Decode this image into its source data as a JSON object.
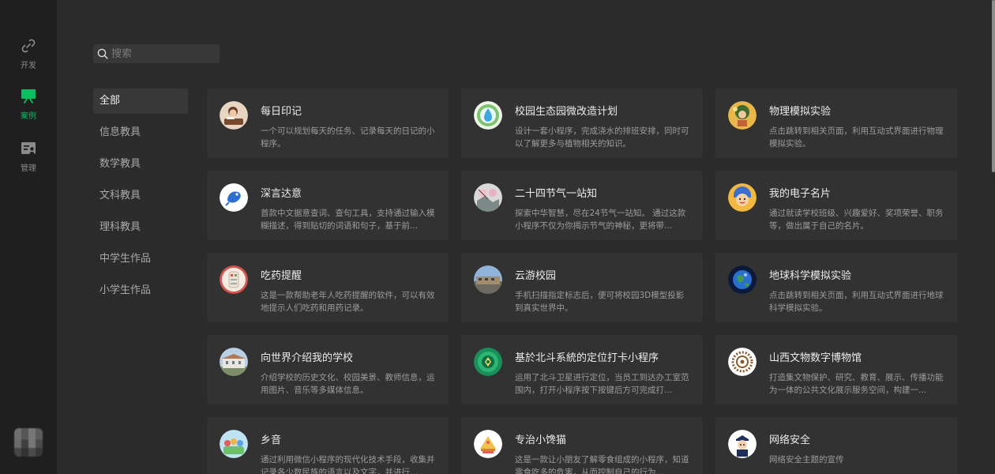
{
  "rail": {
    "items": [
      {
        "label": "开发",
        "icon": "link-icon"
      },
      {
        "label": "案例",
        "icon": "showcase-icon"
      },
      {
        "label": "管理",
        "icon": "manage-icon"
      }
    ],
    "active_color": "#07c160"
  },
  "search": {
    "placeholder": "搜索"
  },
  "categories": [
    "全部",
    "信息教具",
    "数学教具",
    "文科教具",
    "理科教具",
    "中学生作品",
    "小学生作品"
  ],
  "cards": [
    {
      "title": "每日印记",
      "desc": "一个可以规划每天的任务、记录每天的日记的小程序。"
    },
    {
      "title": "校园生态园微改造计划",
      "desc": "设计一套小程序，完成浇水的排班安排，同时可以了解更多与植物相关的知识。"
    },
    {
      "title": "物理模拟实验",
      "desc": "点击跳转到相关页面，利用互动式界面进行物理模拟实验。"
    },
    {
      "title": "深言达意",
      "desc": "首款中文据意查词、查句工具，支持通过输入模糊描述，得到贴切的词语和句子，基于前..."
    },
    {
      "title": "二十四节气一站知",
      "desc": "探索中华智慧，尽在24节气一站知。 通过这款小程序不仅为你揭示节气的神秘，更将带..."
    },
    {
      "title": "我的电子名片",
      "desc": "通过就读学校班级、兴趣爱好、奖项荣誉、职务等，做出属于自己的名片。"
    },
    {
      "title": "吃药提醒",
      "desc": "这是一款帮助老年人吃药提醒的软件，可以有效地提示人们吃药和用药记录。"
    },
    {
      "title": "云游校园",
      "desc": "手机扫描指定标志后，便可将校园3D模型投影到真实世界中。"
    },
    {
      "title": "地球科学模拟实验",
      "desc": "点击跳转到相关页面，利用互动式界面进行地球科学模拟实验。"
    },
    {
      "title": "向世界介绍我的学校",
      "desc": "介绍学校的历史文化、校园美景、教师信息，运用图片、音乐等多媒体信息。"
    },
    {
      "title": "基於北斗系統的定位打卡小程序",
      "desc": "运用了北斗卫星进行定位，当员工到达办工室范围内，打开小程序按下按键后方可完成打..."
    },
    {
      "title": "山西文物数字博物馆",
      "desc": "打造集文物保护、研究、教育、展示、传播功能为一体的公共文化展示服务空间，构建一..."
    },
    {
      "title": "乡音",
      "desc": "通过利用微信小程序的现代化技术手段，收集并记录各少数民族的语言以及文字，并进行..."
    },
    {
      "title": "专治小馋猫",
      "desc": "这是一款让小朋友了解零食组成的小程序，知道零食吃多的危害，从而控制自己的行为..."
    },
    {
      "title": "网络安全",
      "desc": "网络安全主题的宣传"
    }
  ]
}
